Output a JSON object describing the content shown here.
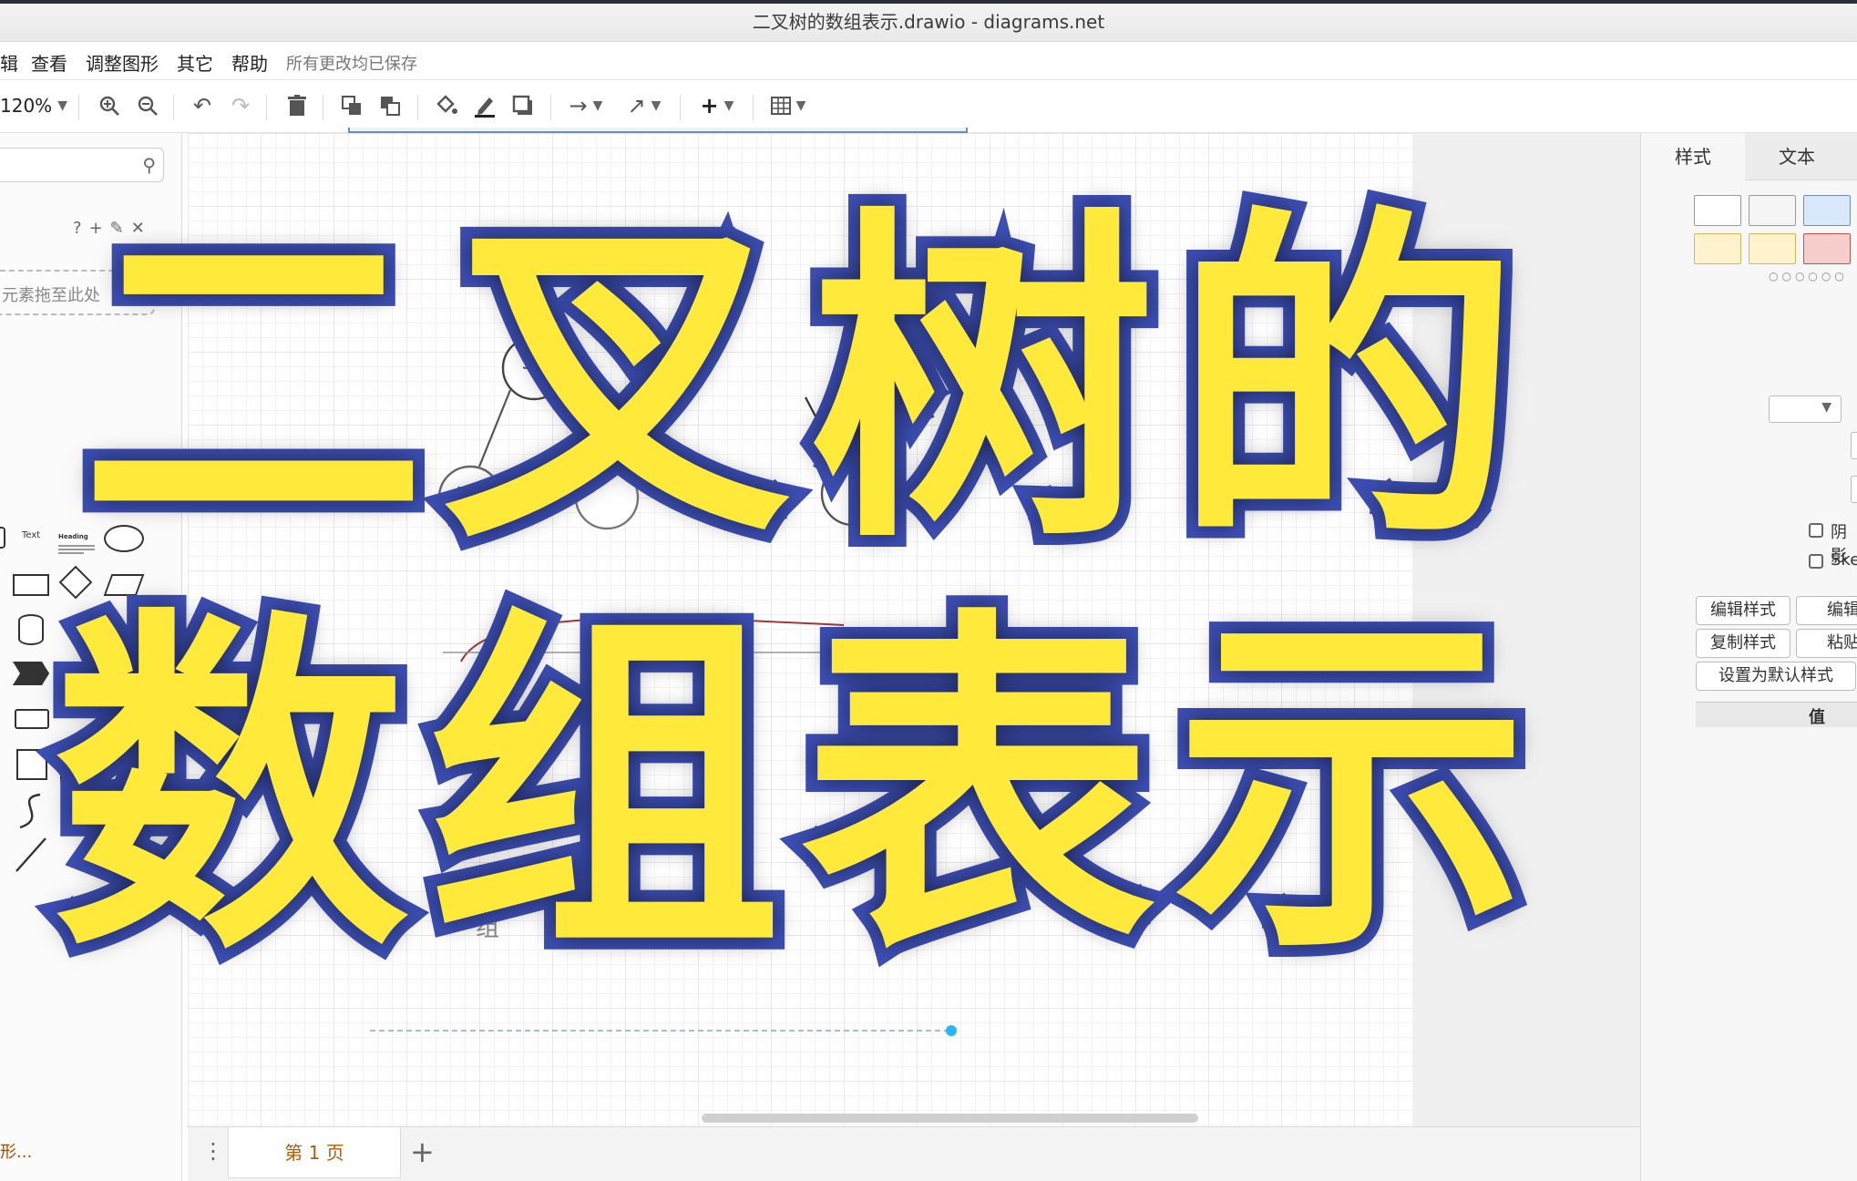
{
  "window": {
    "title": "二叉树的数组表示.drawio - diagrams.net"
  },
  "menu": {
    "items": [
      "辑",
      "查看",
      "调整图形",
      "其它",
      "帮助"
    ],
    "save_status": "所有更改均已保存"
  },
  "toolbar": {
    "zoom": "120%"
  },
  "left_panel": {
    "scratchpad_hint": "元素拖至此处",
    "shape_text_label": "Text",
    "shape_heading_label": "Heading",
    "more_shapes": "形..."
  },
  "canvas": {
    "node_label": "3",
    "fragment_zero": "0",
    "fragment_group": "组"
  },
  "page_bar": {
    "current_page": "第 1 页"
  },
  "right_panel": {
    "tabs": [
      "样式",
      "文本"
    ],
    "swatch_colors": [
      "#ffffff",
      "#f5f5f5",
      "#dae8fc",
      "#fff2cc",
      "#fff2cc",
      "#f8cecc"
    ],
    "shadow_label": "阴影",
    "sketch_label": "Sket",
    "edit_style_label": "编辑样式",
    "edit_label": "编辑",
    "copy_style_label": "复制样式",
    "paste_label": "粘贴",
    "set_default_label": "设置为默认样式",
    "value_header": "值"
  },
  "overlay": {
    "line1": "二叉树的",
    "line2": "数组表示"
  },
  "colors": {
    "overlay_fill": "#ffe93a",
    "overlay_stroke": "#3d4fb5",
    "page_tab_text": "#b55b00"
  }
}
